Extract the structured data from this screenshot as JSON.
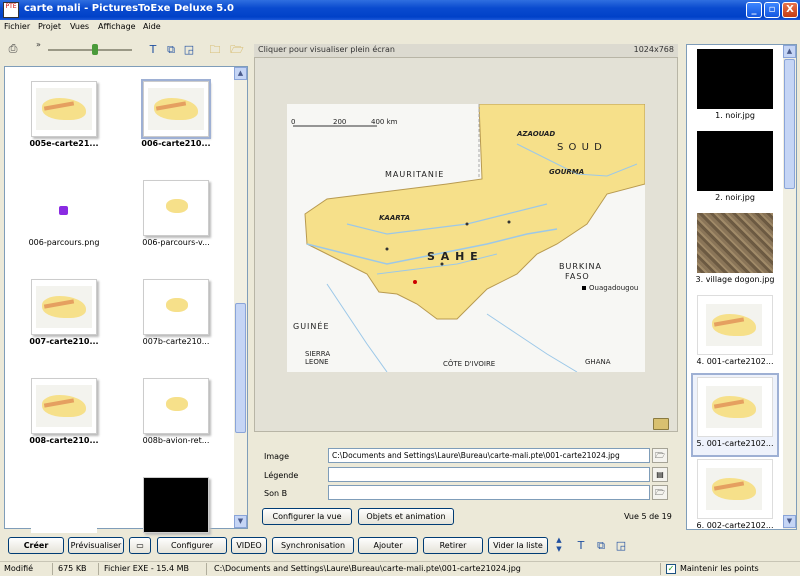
{
  "window": {
    "title": "carte mali - PicturesToExe Deluxe 5.0",
    "icon_label": "PTE",
    "controls": [
      "_",
      "▫",
      "X"
    ]
  },
  "menu": [
    "Fichier",
    "Projet",
    "Vues",
    "Affichage",
    "Aide"
  ],
  "left_panel": {
    "thumbnails": [
      {
        "label": "005e-carte21...",
        "kind": "map",
        "bold": true,
        "selected": false
      },
      {
        "label": "006-carte210...",
        "kind": "map",
        "bold": true,
        "selected": true
      },
      {
        "label": "006-parcours.png",
        "kind": "purple",
        "bold": false,
        "selected": false
      },
      {
        "label": "006-parcours-v...",
        "kind": "blob",
        "bold": false,
        "selected": false
      },
      {
        "label": "007-carte210...",
        "kind": "map",
        "bold": true,
        "selected": false
      },
      {
        "label": "007b-carte210...",
        "kind": "blob",
        "bold": false,
        "selected": false
      },
      {
        "label": "008-carte210...",
        "kind": "map",
        "bold": true,
        "selected": false
      },
      {
        "label": "008b-avion-ret...",
        "kind": "blob",
        "bold": false,
        "selected": false
      },
      {
        "label": "",
        "kind": "blank",
        "bold": false,
        "selected": false
      },
      {
        "label": "",
        "kind": "black",
        "bold": false,
        "selected": false
      }
    ]
  },
  "preview": {
    "hint": "Cliquer pour visualiser plein écran",
    "resolution": "1024x768",
    "map_labels": {
      "country1": "MAURITANIE",
      "country2": "S O U D",
      "country3": "S A H E",
      "burkina": "BURKINA",
      "faso": "FASO",
      "guinee": "GUINÉE",
      "sierra": "SIERRA",
      "leone": "LEONE",
      "cote": "CÔTE D'IVOIRE",
      "ghana": "GHANA",
      "ouaga": "Ouagadougou",
      "kaarta": "KAARTA",
      "azaouad": "AZAOUAD",
      "gourma": "GOURMA",
      "scale0": "0",
      "scale1": "200",
      "scale2": "400 km"
    }
  },
  "fields": {
    "image_label": "Image",
    "image_value": "C:\\Documents and Settings\\Laure\\Bureau\\carte-mali.pte\\001-carte21024.jpg",
    "legende_label": "Légende",
    "legende_value": "",
    "son_label": "Son B",
    "son_value": "",
    "configure_view": "Configurer la vue",
    "objects_anim": "Objets et animation",
    "view_count": "Vue 5 de 19"
  },
  "right_panel": {
    "thumbnails": [
      {
        "label": "1. noir.jpg",
        "kind": "black",
        "selected": false
      },
      {
        "label": "2. noir.jpg",
        "kind": "black",
        "selected": false
      },
      {
        "label": "3. village dogon.jpg",
        "kind": "village",
        "selected": false
      },
      {
        "label": "4. 001-carte2102...",
        "kind": "map",
        "selected": false
      },
      {
        "label": "5. 001-carte2102...",
        "kind": "map",
        "selected": true
      },
      {
        "label": "6. 002-carte2102...",
        "kind": "map",
        "selected": false
      }
    ]
  },
  "bottom_toolbar": {
    "create": "Créer",
    "preview": "Prévisualiser",
    "configure": "Configurer",
    "video": "VIDEO",
    "sync": "Synchronisation",
    "add": "Ajouter",
    "remove": "Retirer",
    "empty": "Vider la liste"
  },
  "status": {
    "state": "Modifié",
    "size": "675 KB",
    "exe": "Fichier EXE - 15.4 MB",
    "path": "C:\\Documents and Settings\\Laure\\Bureau\\carte-mali.pte\\001-carte21024.jpg",
    "keep_points": "Maintenir les points"
  },
  "colors": {
    "titlebar": "#0a4bcf",
    "map_yellow": "#f6e08a",
    "map_water": "#9cc8e8"
  }
}
